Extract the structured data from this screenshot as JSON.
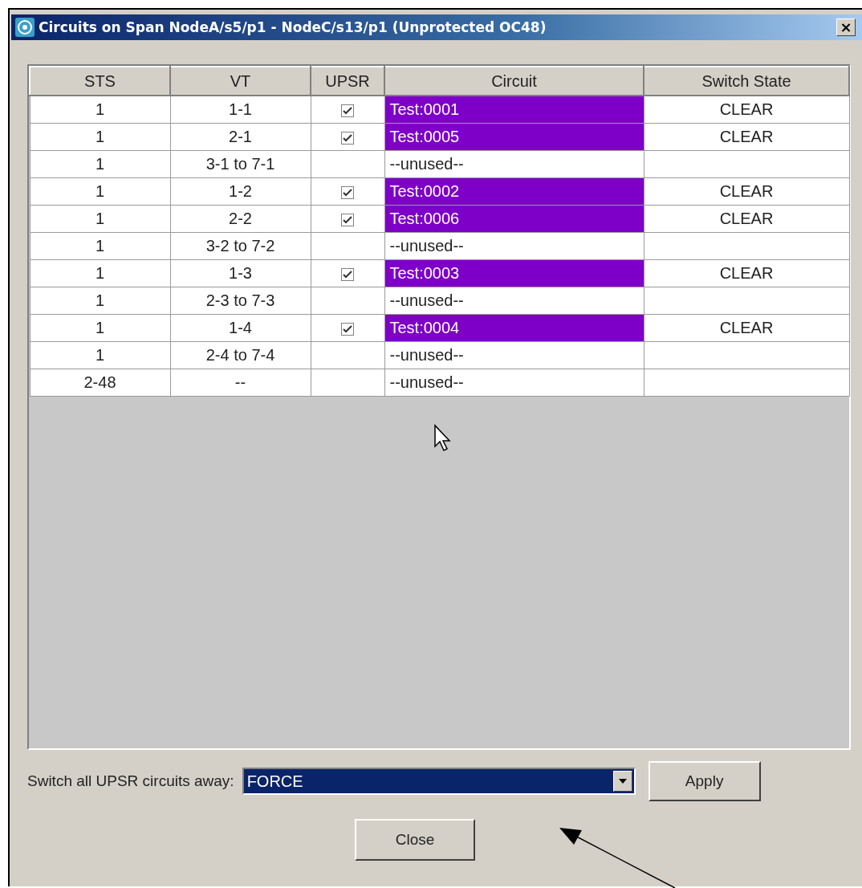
{
  "window": {
    "title": "Circuits on Span NodeA/s5/p1 - NodeC/s13/p1 (Unprotected OC48)",
    "close": "×"
  },
  "table": {
    "columns": [
      "STS",
      "VT",
      "UPSR",
      "Circuit",
      "Switch State"
    ],
    "rows": [
      {
        "sts": "1",
        "vt": "1-1",
        "upsr": true,
        "circuit": "Test:0001",
        "highlighted": true,
        "switch_state": "CLEAR"
      },
      {
        "sts": "1",
        "vt": "2-1",
        "upsr": true,
        "circuit": "Test:0005",
        "highlighted": true,
        "switch_state": "CLEAR"
      },
      {
        "sts": "1",
        "vt": "3-1 to 7-1",
        "upsr": false,
        "circuit": "--unused--",
        "highlighted": false
      },
      {
        "sts": "1",
        "vt": "1-2",
        "upsr": true,
        "circuit": "Test:0002",
        "highlighted": true,
        "switch_state": "CLEAR"
      },
      {
        "sts": "1",
        "vt": "2-2",
        "upsr": true,
        "circuit": "Test:0006",
        "highlighted": true,
        "switch_state": "CLEAR"
      },
      {
        "sts": "1",
        "vt": "3-2 to 7-2",
        "upsr": false,
        "circuit": "--unused--",
        "highlighted": false
      },
      {
        "sts": "1",
        "vt": "1-3",
        "upsr": true,
        "circuit": "Test:0003",
        "highlighted": true,
        "switch_state": "CLEAR"
      },
      {
        "sts": "1",
        "vt": "2-3 to 7-3",
        "upsr": false,
        "circuit": "--unused--",
        "highlighted": false
      },
      {
        "sts": "1",
        "vt": "1-4",
        "upsr": true,
        "circuit": "Test:0004",
        "highlighted": true,
        "switch_state": "CLEAR"
      },
      {
        "sts": "1",
        "vt": "2-4 to 7-4",
        "upsr": false,
        "circuit": "--unused--",
        "highlighted": false
      },
      {
        "sts": "2-48",
        "vt": "--",
        "upsr": false,
        "circuit": "--unused--",
        "highlighted": false
      }
    ]
  },
  "switch_all": {
    "label": "Switch all UPSR circuits away:",
    "value": "FORCE",
    "apply": "Apply"
  },
  "buttons": [
    "Close"
  ]
}
